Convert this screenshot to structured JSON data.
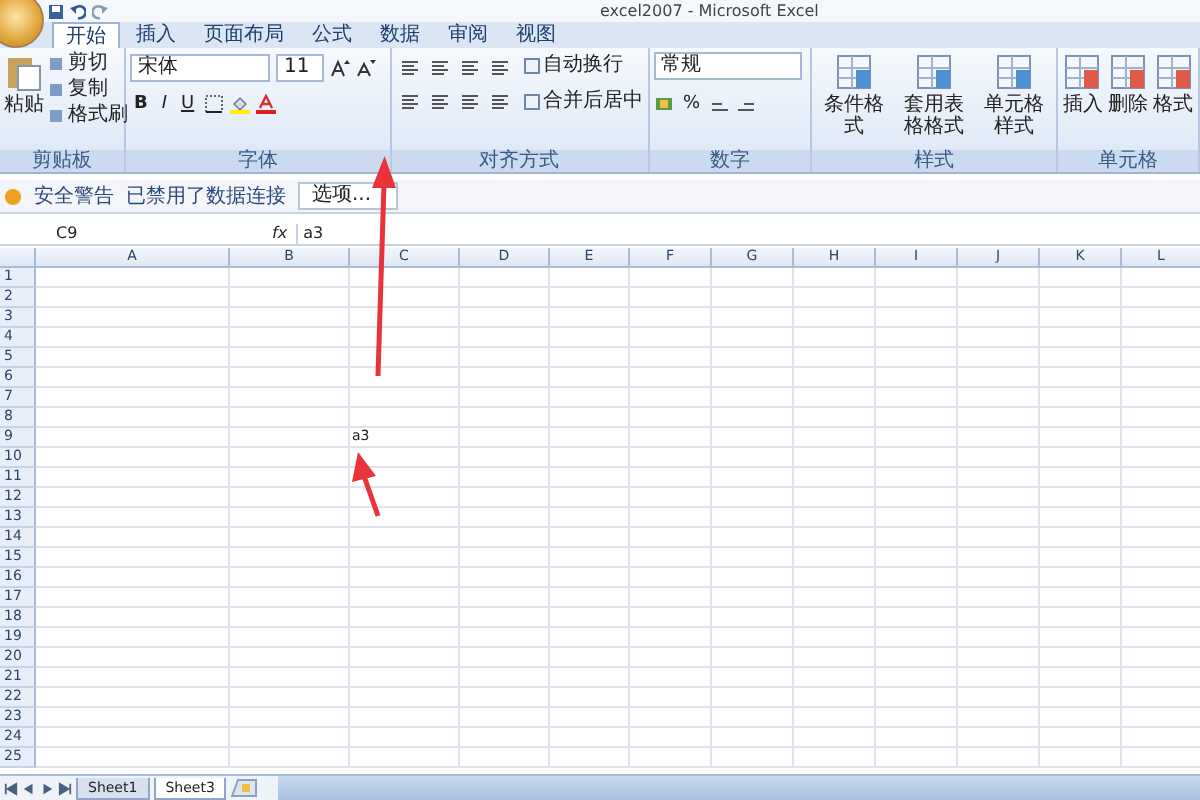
{
  "title": "excel2007 - Microsoft Excel",
  "ribbon_tabs": [
    {
      "label": "开始",
      "selected": true
    },
    {
      "label": "插入",
      "selected": false
    },
    {
      "label": "页面布局",
      "selected": false
    },
    {
      "label": "公式",
      "selected": false
    },
    {
      "label": "数据",
      "selected": false
    },
    {
      "label": "审阅",
      "selected": false
    },
    {
      "label": "视图",
      "selected": false
    }
  ],
  "groups": [
    {
      "kind": "clipboard",
      "label": "剪贴板",
      "large": "粘贴",
      "small": [
        "剪切",
        "复制",
        "格式刷"
      ]
    },
    {
      "kind": "font",
      "label": "字体",
      "font": "宋体",
      "size": "11",
      "styles": [
        "B",
        "I",
        "U"
      ]
    },
    {
      "kind": "alignment",
      "label": "对齐方式",
      "small": [
        "自动换行",
        "合并后居中"
      ]
    },
    {
      "kind": "number",
      "label": "数字",
      "format": "常规",
      "symbol": "%"
    },
    {
      "kind": "styles",
      "label": "样式",
      "large": [
        "条件格式",
        "套用表格格式",
        "单元格样式"
      ]
    },
    {
      "kind": "cells",
      "label": "单元格",
      "large": [
        "插入",
        "删除",
        "格式"
      ]
    }
  ],
  "security_bar": {
    "title": "安全警告",
    "message": "已禁用了数据连接",
    "button": "选项..."
  },
  "formula_bar": {
    "name_box": "C9",
    "fx": "fx",
    "value": "a3"
  },
  "sheet": {
    "columns": [
      "A",
      "B",
      "C",
      "D",
      "E",
      "F",
      "G",
      "H",
      "I",
      "J",
      "K",
      "L"
    ],
    "rows": [
      {
        "label": "1"
      },
      {
        "label": "2"
      },
      {
        "label": "3"
      },
      {
        "label": "4"
      },
      {
        "label": "5"
      },
      {
        "label": "6"
      },
      {
        "label": "7"
      },
      {
        "label": "8"
      },
      {
        "label": "9",
        "cells": [
          null,
          null,
          "a3"
        ]
      },
      {
        "label": "10"
      },
      {
        "label": "11"
      },
      {
        "label": "12"
      },
      {
        "label": "13"
      },
      {
        "label": "14"
      },
      {
        "label": "15"
      },
      {
        "label": "16"
      },
      {
        "label": "17"
      },
      {
        "label": "18"
      },
      {
        "label": "19"
      },
      {
        "label": "20"
      },
      {
        "label": "21"
      },
      {
        "label": "22"
      },
      {
        "label": "23"
      },
      {
        "label": "24"
      },
      {
        "label": "25"
      }
    ]
  },
  "sheet_tabs": [
    {
      "label": "Sheet1",
      "selected": false
    },
    {
      "label": "Sheet3",
      "selected": true
    }
  ]
}
